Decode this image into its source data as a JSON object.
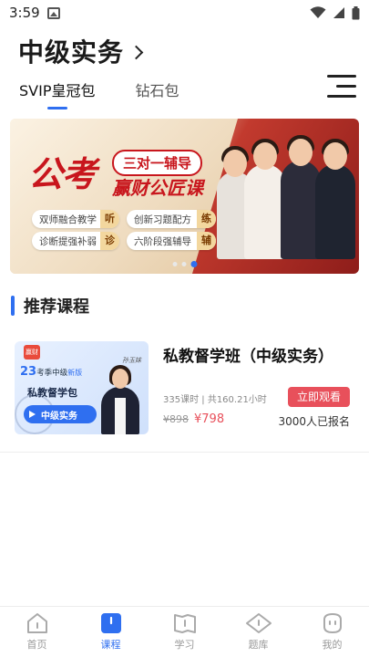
{
  "status_bar": {
    "time": "3:59"
  },
  "header": {
    "title": "中级实务"
  },
  "tabs": [
    {
      "label": "SVIP皇冠包",
      "active": true
    },
    {
      "label": "钻石包",
      "active": false
    }
  ],
  "banner": {
    "main_title": "公考",
    "tag": "三对一辅导",
    "sub_title": "赢财公匠课",
    "features": [
      {
        "text": "双师融合教学",
        "highlight": "听"
      },
      {
        "text": "创新习题配方",
        "highlight": "练"
      },
      {
        "text": "诊断提强补弱",
        "highlight": "诊"
      },
      {
        "text": "六阶段强辅导",
        "highlight": "辅"
      }
    ],
    "active_slide": 3,
    "slide_count": 3
  },
  "section": {
    "title": "推荐课程"
  },
  "course": {
    "thumb": {
      "logo_text": "赢财",
      "year": "23",
      "season": "考季中级",
      "badge": "新版",
      "package": "私教督学包",
      "play_label": "中级实务",
      "signature": "孙玉妹"
    },
    "name": "私教督学班（中级实务）",
    "meta": "335课时 | 共160.21小时",
    "watch_label": "立即观看",
    "old_price": "¥898",
    "price": "¥798",
    "enrolled": "3000人已报名"
  },
  "bottom_nav": [
    {
      "label": "首页",
      "icon": "home-icon",
      "active": false
    },
    {
      "label": "课程",
      "icon": "course-icon",
      "active": true
    },
    {
      "label": "学习",
      "icon": "study-icon",
      "active": false
    },
    {
      "label": "题库",
      "icon": "question-bank-icon",
      "active": false
    },
    {
      "label": "我的",
      "icon": "profile-icon",
      "active": false
    }
  ],
  "colors": {
    "accent": "#2f6ff0",
    "price_red": "#e8505b",
    "banner_red": "#c8161d"
  }
}
